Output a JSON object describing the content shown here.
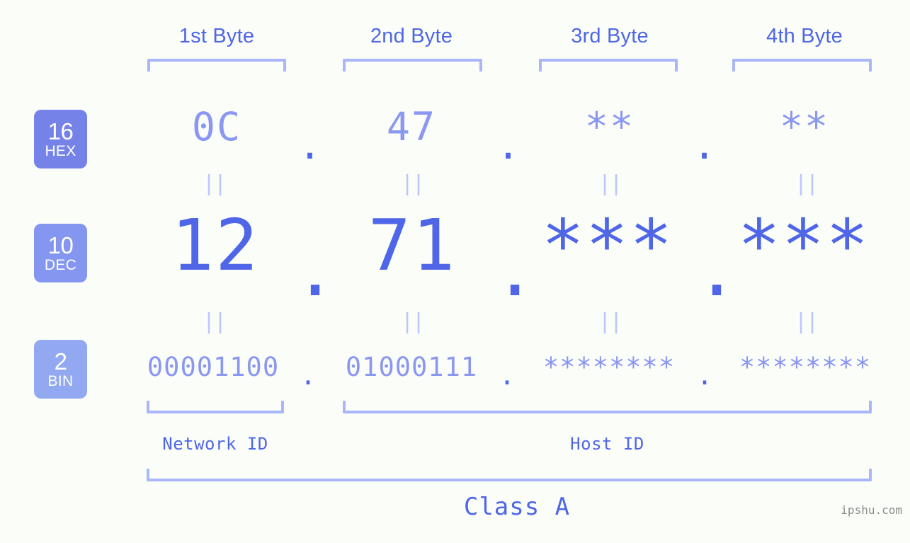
{
  "meta": {
    "background": "#fbfdf9",
    "accent_strong": "#4f66e8",
    "accent_mid": "#8b97f0",
    "accent_light": "#aab6fa",
    "watermark": "ipshu.com"
  },
  "byte_headers": [
    {
      "label": "1st Byte"
    },
    {
      "label": "2nd Byte"
    },
    {
      "label": "3rd Byte"
    },
    {
      "label": "4th Byte"
    }
  ],
  "bases": [
    {
      "number": "16",
      "name": "HEX",
      "color": "#7583e8"
    },
    {
      "number": "10",
      "name": "DEC",
      "color": "#8496ef"
    },
    {
      "number": "2",
      "name": "BIN",
      "color": "#92a8f0"
    }
  ],
  "rows": {
    "hex": {
      "base_number": "16",
      "base_name": "HEX",
      "values": [
        "0C",
        "47",
        "**",
        "**"
      ],
      "separator": "."
    },
    "dec": {
      "base_number": "10",
      "base_name": "DEC",
      "values": [
        "12",
        "71",
        "***",
        "***"
      ],
      "separator": "."
    },
    "bin": {
      "base_number": "2",
      "base_name": "BIN",
      "values": [
        "00001100",
        "01000111",
        "********",
        "********"
      ],
      "separator": "."
    }
  },
  "equals_marks": {
    "glyph": "||",
    "hex_to_dec": [
      "||",
      "||",
      "||",
      "||"
    ],
    "dec_to_bin": [
      "||",
      "||",
      "||",
      "||"
    ]
  },
  "sections": {
    "network_id": "Network ID",
    "host_id": "Host ID",
    "class": "Class A"
  }
}
